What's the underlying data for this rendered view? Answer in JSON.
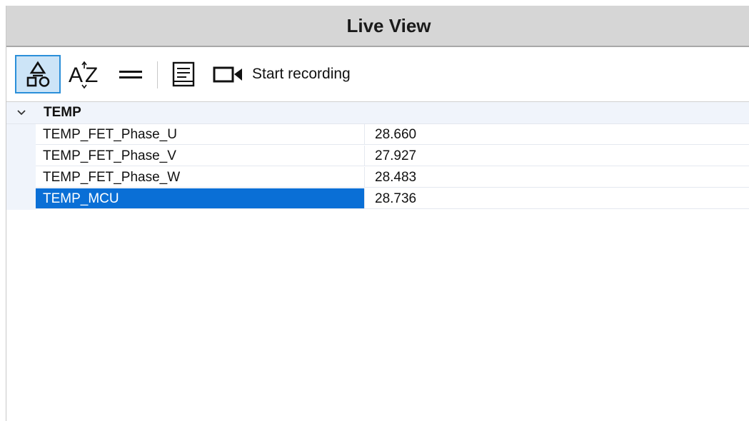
{
  "window": {
    "title": "Live View"
  },
  "toolbar": {
    "buttons": [
      {
        "name": "categorized",
        "icon": "shapes-icon",
        "selected": true
      },
      {
        "name": "sort-alphabetical",
        "icon": "sort-az-icon",
        "selected": false
      },
      {
        "name": "collapse-all",
        "icon": "equals-icon",
        "selected": false
      },
      {
        "name": "log",
        "icon": "notepad-icon",
        "selected": false
      },
      {
        "name": "record",
        "icon": "video-camera-icon",
        "selected": false
      }
    ],
    "record_label": "Start recording"
  },
  "grid": {
    "groups": [
      {
        "label": "TEMP",
        "expanded": true,
        "rows": [
          {
            "name": "TEMP_FET_Phase_U",
            "value": "28.660"
          },
          {
            "name": "TEMP_FET_Phase_V",
            "value": "27.927"
          },
          {
            "name": "TEMP_FET_Phase_W",
            "value": "28.483"
          },
          {
            "name": "TEMP_MCU",
            "value": "28.736",
            "selected": true
          }
        ]
      }
    ]
  },
  "colors": {
    "titlebar_bg": "#d6d6d6",
    "group_bg": "#f0f4fb",
    "selection": "#0a6fd6",
    "toolbar_selected_bg": "#cce4f7",
    "toolbar_selected_border": "#2b8fd9"
  }
}
